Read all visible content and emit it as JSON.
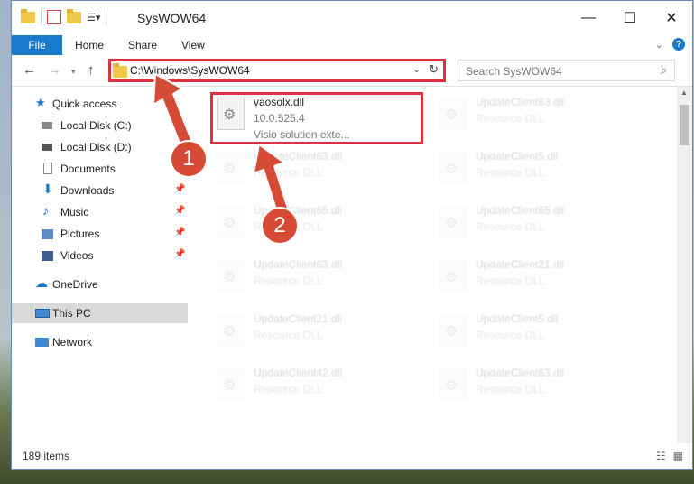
{
  "window": {
    "title": "SysWOW64"
  },
  "window_buttons": {
    "minimize": "—",
    "maximize": "☐",
    "close": "✕"
  },
  "ribbon": {
    "tabs": [
      "File",
      "Home",
      "Share",
      "View"
    ],
    "help": "?"
  },
  "nav": {
    "back": "←",
    "forward": "→",
    "up": "↑",
    "address": "C:\\Windows\\SysWOW64",
    "refresh": "↻",
    "search_placeholder": "Search SysWOW64"
  },
  "sidebar": {
    "items": [
      {
        "label": "Quick access",
        "icon": "star-icon"
      },
      {
        "label": "Local Disk (C:)",
        "icon": "drive-icon"
      },
      {
        "label": "Local Disk (D:)",
        "icon": "drive-icon"
      },
      {
        "label": "Documents",
        "icon": "document-icon",
        "pinned": true
      },
      {
        "label": "Downloads",
        "icon": "download-icon",
        "pinned": true
      },
      {
        "label": "Music",
        "icon": "music-icon",
        "pinned": true
      },
      {
        "label": "Pictures",
        "icon": "pictures-icon",
        "pinned": true
      },
      {
        "label": "Videos",
        "icon": "videos-icon",
        "pinned": true
      },
      {
        "label": "OneDrive",
        "icon": "cloud-icon"
      },
      {
        "label": "This PC",
        "icon": "pc-icon",
        "selected": true
      },
      {
        "label": "Network",
        "icon": "network-icon"
      }
    ],
    "pin": "📌"
  },
  "files": {
    "highlighted": {
      "name": "vaosolx.dll",
      "version": "10.0.525.4",
      "description": "Visio solution exte..."
    },
    "faded": [
      {
        "name": "UpdateClient63.dll",
        "description": "Resource DLL"
      },
      {
        "name": "UpdateClient63.dll",
        "description": "Resource DLL"
      },
      {
        "name": "UpdateClient5.dll",
        "description": "Resource DLL"
      },
      {
        "name": "UpdateClient65.dll",
        "description": "Resource DLL"
      },
      {
        "name": "UpdateClient65.dll",
        "description": "Resource DLL"
      },
      {
        "name": "UpdateClient63.dll",
        "description": "Resource DLL"
      },
      {
        "name": "UpdateClient21.dll",
        "description": "Resource DLL"
      },
      {
        "name": "UpdateClient21.dll",
        "description": "Resource DLL"
      },
      {
        "name": "UpdateClient5.dll",
        "description": "Resource DLL"
      },
      {
        "name": "UpdateClient42.dll",
        "description": "Resource DLL"
      },
      {
        "name": "UpdateClient63.dll",
        "description": "Resource DLL"
      }
    ]
  },
  "status": {
    "items": "189 items"
  },
  "annotations": {
    "step1": "1",
    "step2": "2",
    "color": "#d74b36"
  }
}
